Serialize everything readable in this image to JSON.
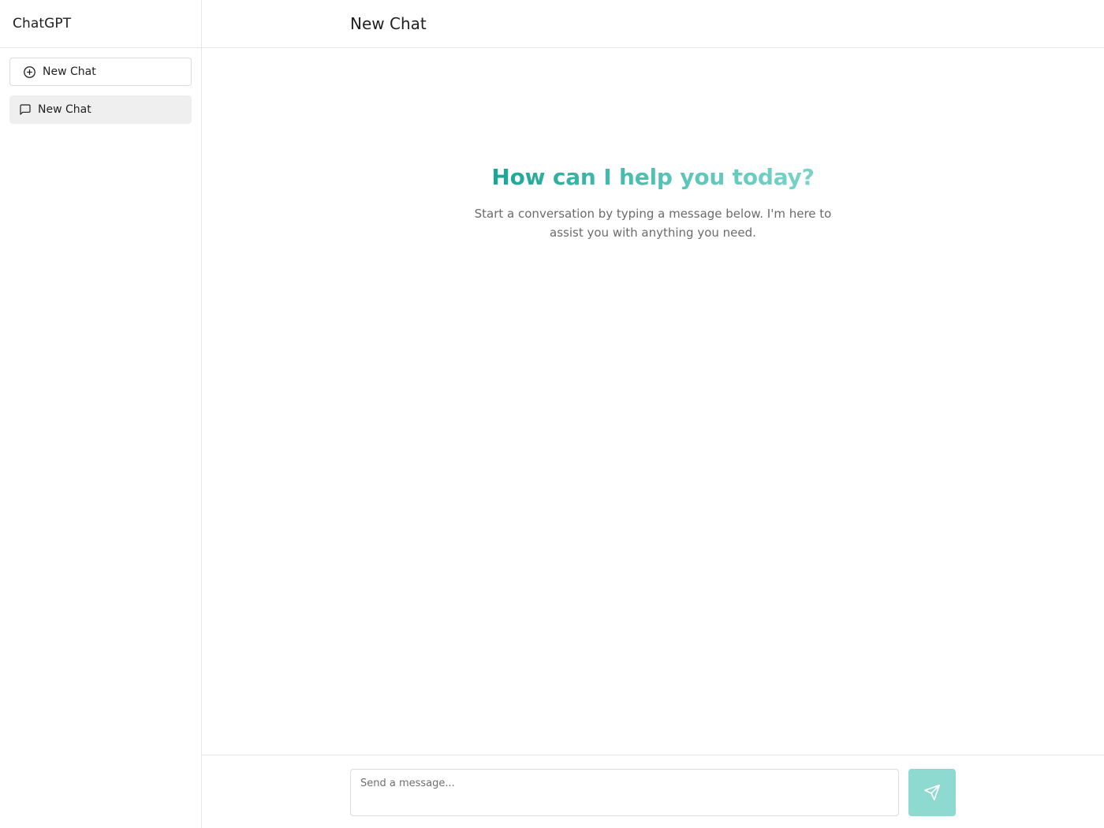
{
  "app": {
    "title": "ChatGPT"
  },
  "sidebar": {
    "new_chat_button": {
      "label": "New Chat",
      "icon": "plus-circle-icon"
    },
    "chats": [
      {
        "label": "New Chat",
        "icon": "message-square-icon",
        "selected": true
      }
    ]
  },
  "main": {
    "header_title": "New Chat",
    "welcome": {
      "heading": "How can I help you today?",
      "subtext": "Start a conversation by typing a message below. I'm here to assist you with anything you need."
    }
  },
  "composer": {
    "placeholder": "Send a message...",
    "value": "",
    "send_icon": "send-icon"
  },
  "colors": {
    "accent": "#1aa595",
    "accent_light": "#8ed9d0",
    "selected_bg": "#efefef",
    "border": "#e6e6e6"
  }
}
